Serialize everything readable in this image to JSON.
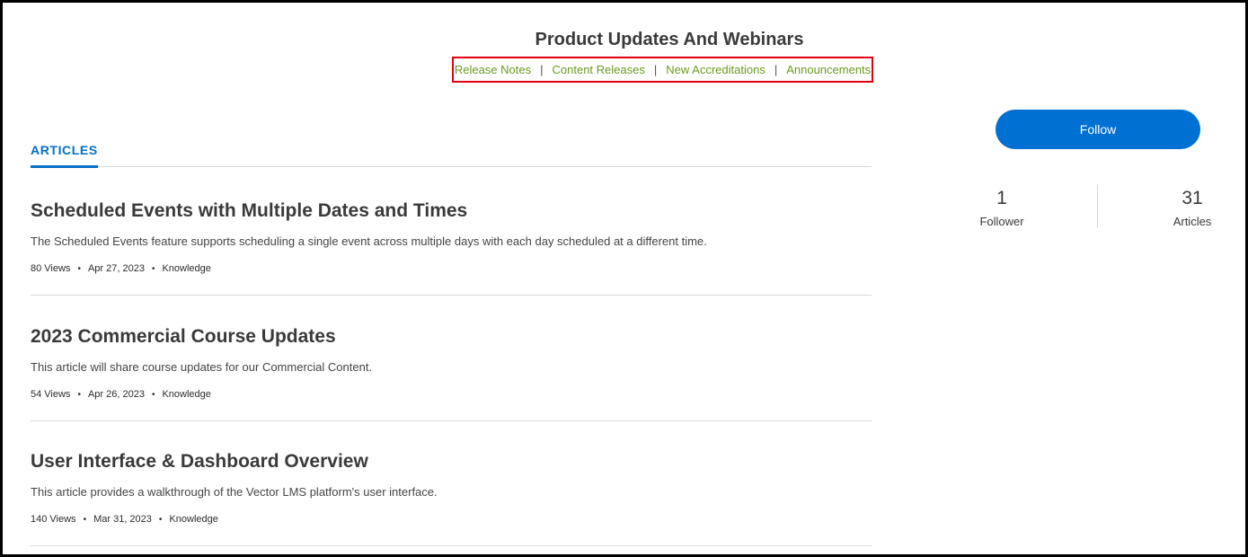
{
  "header": {
    "title": "Product Updates And Webinars"
  },
  "subnav": {
    "links": [
      "Release Notes",
      "Content Releases",
      "New Accreditations",
      "Announcements"
    ],
    "separator": "|"
  },
  "tabs": {
    "articles_label": "ARTICLES"
  },
  "articles": [
    {
      "title": "Scheduled Events with Multiple Dates and Times",
      "summary": "The Scheduled Events feature supports scheduling a single event across multiple days with each day scheduled at a different time.",
      "views": "80 Views",
      "date": "Apr 27, 2023",
      "type": "Knowledge"
    },
    {
      "title": "2023 Commercial Course Updates",
      "summary": "This article will share course updates for our Commercial Content.",
      "views": "54 Views",
      "date": "Apr 26, 2023",
      "type": "Knowledge"
    },
    {
      "title": "User Interface & Dashboard Overview",
      "summary": "This article provides a walkthrough of the Vector LMS platform's user interface.",
      "views": "140 Views",
      "date": "Mar 31, 2023",
      "type": "Knowledge"
    }
  ],
  "sidebar": {
    "follow_label": "Follow",
    "followers_count": "1",
    "followers_label": "Follower",
    "articles_count": "31",
    "articles_label": "Articles"
  },
  "colors": {
    "link_green": "#6b9a1f",
    "accent_blue": "#0070d2",
    "highlight_red": "#e3000f"
  }
}
